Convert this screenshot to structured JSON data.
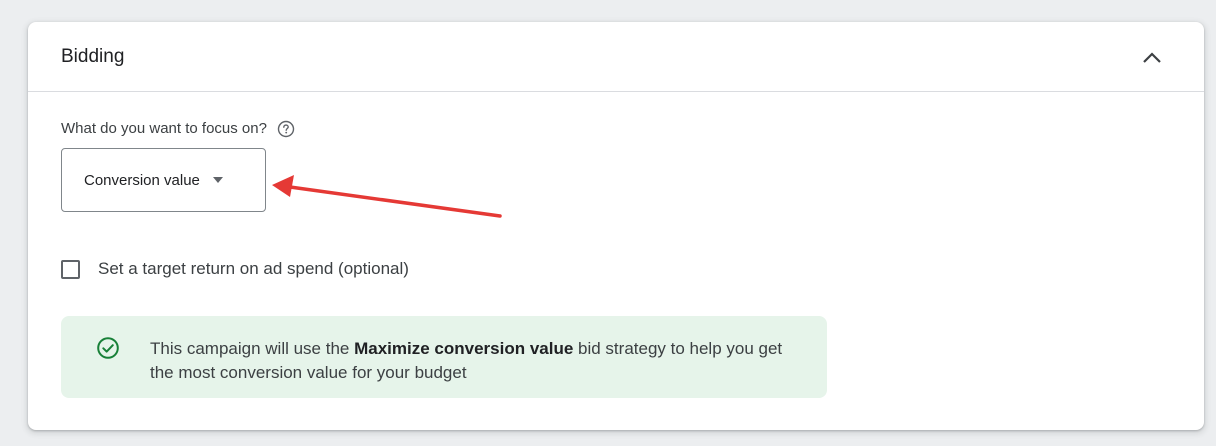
{
  "section": {
    "title": "Bidding",
    "collapse_icon": "chevron-up-icon"
  },
  "focus": {
    "label": "What do you want to focus on?",
    "help_icon": "help-circle-icon",
    "selected": "Conversion value",
    "dropdown_icon": "caret-down-icon"
  },
  "annotation": {
    "arrow_color": "#e53935"
  },
  "target": {
    "checkbox_label": "Set a target return on ad spend (optional)",
    "checked": false
  },
  "info": {
    "icon": "check-circle-icon",
    "text_before": "This campaign will use the ",
    "text_bold": "Maximize conversion value",
    "text_after": " bid strategy to help you get the most conversion value for your budget",
    "background": "#e6f4ea",
    "icon_color": "#188038"
  }
}
